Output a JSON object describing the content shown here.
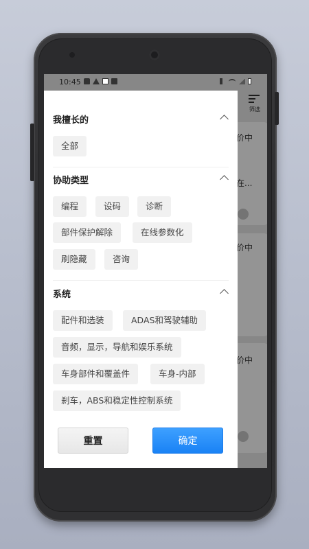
{
  "status_bar": {
    "time": "10:45",
    "left_icons": [
      "bag-icon",
      "warning-icon",
      "image-icon",
      "document-icon"
    ],
    "right_icons": [
      "mute-icon",
      "wifi-icon",
      "signal-icon",
      "battery-icon"
    ]
  },
  "background_screen": {
    "filter_label": "筛选",
    "card_snippets": [
      "价中",
      "在...",
      "价中",
      "价中"
    ]
  },
  "filter_panel": {
    "sections": [
      {
        "title": "我擅长的",
        "tags": [
          "全部"
        ]
      },
      {
        "title": "协助类型",
        "tags": [
          "编程",
          "设码",
          "诊断",
          "部件保护解除",
          "在线参数化",
          "刷隐藏",
          "咨询"
        ]
      },
      {
        "title": "系统",
        "tags": [
          "配件和选装",
          "ADAS和驾驶辅助",
          "音频，显示，导航和娱乐系统",
          "车身部件和覆盖件",
          "车身-内部",
          "刹车，ABS和稳定性控制系统"
        ]
      }
    ],
    "reset_label": "重置",
    "confirm_label": "确定"
  },
  "colors": {
    "accent": "#1a82f5",
    "tag_bg": "#f1f1f1",
    "panel_bg": "#ffffff"
  }
}
